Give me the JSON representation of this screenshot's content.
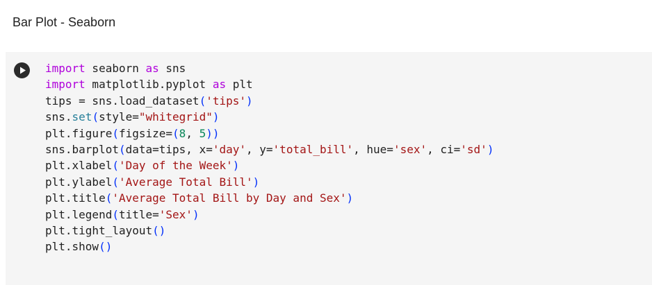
{
  "notebook": {
    "heading": "Bar Plot - Seaborn",
    "cell": {
      "run_icon": "play-icon",
      "code_lines": [
        [
          [
            "kw",
            "import"
          ],
          [
            "plain",
            " seaborn "
          ],
          [
            "kw",
            "as"
          ],
          [
            "plain",
            " sns"
          ]
        ],
        [
          [
            "kw",
            "import"
          ],
          [
            "plain",
            " matplotlib.pyplot "
          ],
          [
            "kw",
            "as"
          ],
          [
            "plain",
            " plt"
          ]
        ],
        [
          [
            "plain",
            "tips = sns.load_dataset"
          ],
          [
            "par",
            "("
          ],
          [
            "str",
            "'tips'"
          ],
          [
            "par",
            ")"
          ]
        ],
        [
          [
            "plain",
            "sns."
          ],
          [
            "fn",
            "set"
          ],
          [
            "par",
            "("
          ],
          [
            "plain",
            "style="
          ],
          [
            "str",
            "\"whitegrid\""
          ],
          [
            "par",
            ")"
          ]
        ],
        [
          [
            "plain",
            "plt.figure"
          ],
          [
            "par",
            "("
          ],
          [
            "plain",
            "figsize="
          ],
          [
            "par",
            "("
          ],
          [
            "num",
            "8"
          ],
          [
            "plain",
            ", "
          ],
          [
            "num",
            "5"
          ],
          [
            "par",
            "))"
          ]
        ],
        [
          [
            "plain",
            "sns.barplot"
          ],
          [
            "par",
            "("
          ],
          [
            "plain",
            "data=tips, x="
          ],
          [
            "str",
            "'day'"
          ],
          [
            "plain",
            ", y="
          ],
          [
            "str",
            "'total_bill'"
          ],
          [
            "plain",
            ", hue="
          ],
          [
            "str",
            "'sex'"
          ],
          [
            "plain",
            ", ci="
          ],
          [
            "str",
            "'sd'"
          ],
          [
            "par",
            ")"
          ]
        ],
        [
          [
            "plain",
            "plt.xlabel"
          ],
          [
            "par",
            "("
          ],
          [
            "str",
            "'Day of the Week'"
          ],
          [
            "par",
            ")"
          ]
        ],
        [
          [
            "plain",
            "plt.ylabel"
          ],
          [
            "par",
            "("
          ],
          [
            "str",
            "'Average Total Bill'"
          ],
          [
            "par",
            ")"
          ]
        ],
        [
          [
            "plain",
            "plt.title"
          ],
          [
            "par",
            "("
          ],
          [
            "str",
            "'Average Total Bill by Day and Sex'"
          ],
          [
            "par",
            ")"
          ]
        ],
        [
          [
            "plain",
            "plt.legend"
          ],
          [
            "par",
            "("
          ],
          [
            "plain",
            "title="
          ],
          [
            "str",
            "'Sex'"
          ],
          [
            "par",
            ")"
          ]
        ],
        [
          [
            "plain",
            "plt.tight_layout"
          ],
          [
            "par",
            "()"
          ]
        ],
        [
          [
            "plain",
            "plt.show"
          ],
          [
            "par",
            "()"
          ]
        ]
      ]
    }
  }
}
